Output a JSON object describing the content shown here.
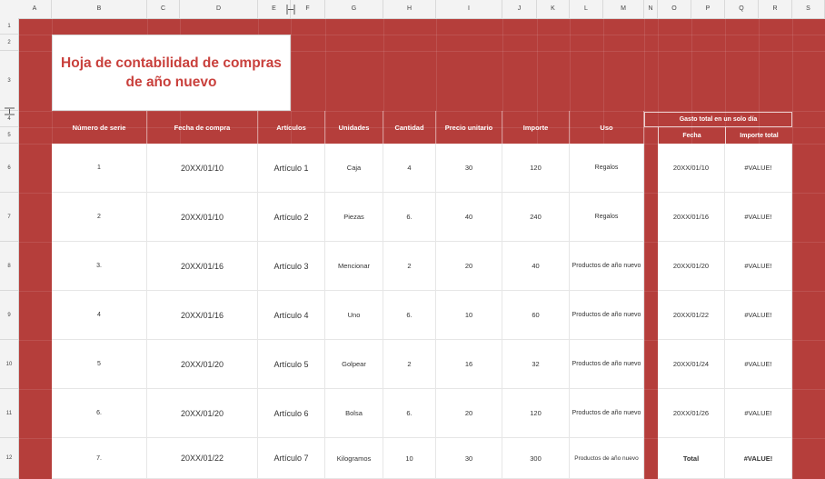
{
  "columns": [
    "A",
    "B",
    "C",
    "D",
    "E",
    "F",
    "G",
    "H",
    "I",
    "J",
    "K",
    "L",
    "M",
    "N",
    "O",
    "P",
    "Q",
    "R",
    "S"
  ],
  "rows": [
    "1",
    "2",
    "3",
    "4",
    "5",
    "6",
    "7",
    "8",
    "9",
    "10",
    "11",
    "12"
  ],
  "title": "Hoja de contabilidad de compras de año nuevo",
  "table": {
    "headers": [
      "Número de serie",
      "Fecha de compra",
      "Artículos",
      "Unidades",
      "Cantidad",
      "Precio unitario",
      "Importe",
      "Uso"
    ],
    "rows": [
      [
        "1",
        "20XX/01/10",
        "Artículo 1",
        "Caja",
        "4",
        "30",
        "120",
        "Regalos"
      ],
      [
        "2",
        "20XX/01/10",
        "Artículo 2",
        "Piezas",
        "6.",
        "40",
        "240",
        "Regalos"
      ],
      [
        "3.",
        "20XX/01/16",
        "Artículo 3",
        "Mencionar",
        "2",
        "20",
        "40",
        "Productos de año nuevo"
      ],
      [
        "4",
        "20XX/01/16",
        "Artículo 4",
        "Uno",
        "6.",
        "10",
        "60",
        "Productos de año nuevo"
      ],
      [
        "5",
        "20XX/01/20",
        "Artículo 5",
        "Golpear",
        "2",
        "16",
        "32",
        "Productos de año nuevo"
      ],
      [
        "6.",
        "20XX/01/20",
        "Artículo 6",
        "Bolsa",
        "6.",
        "20",
        "120",
        "Productos de año nuevo"
      ],
      [
        "7.",
        "20XX/01/22",
        "Artículo 7",
        "Kilogramos",
        "10",
        "30",
        "300",
        "Productos de año nuevo"
      ]
    ]
  },
  "daily": {
    "title": "Gasto total en un solo día",
    "headers": [
      "Fecha",
      "Importe total"
    ],
    "rows": [
      [
        "20XX/01/10",
        "#VALUE!"
      ],
      [
        "20XX/01/16",
        "#VALUE!"
      ],
      [
        "20XX/01/20",
        "#VALUE!"
      ],
      [
        "20XX/01/22",
        "#VALUE!"
      ],
      [
        "20XX/01/24",
        "#VALUE!"
      ],
      [
        "20XX/01/26",
        "#VALUE!"
      ],
      [
        "Total",
        "#VALUE!"
      ]
    ]
  },
  "icons": {
    "corner": "eye-icon",
    "col_resize": "column-resize-icon",
    "row_resize": "row-resize-icon"
  },
  "colors": {
    "accent": "#b53e3b",
    "title_text": "#c9403c",
    "header_bg": "#f3f3f3"
  }
}
